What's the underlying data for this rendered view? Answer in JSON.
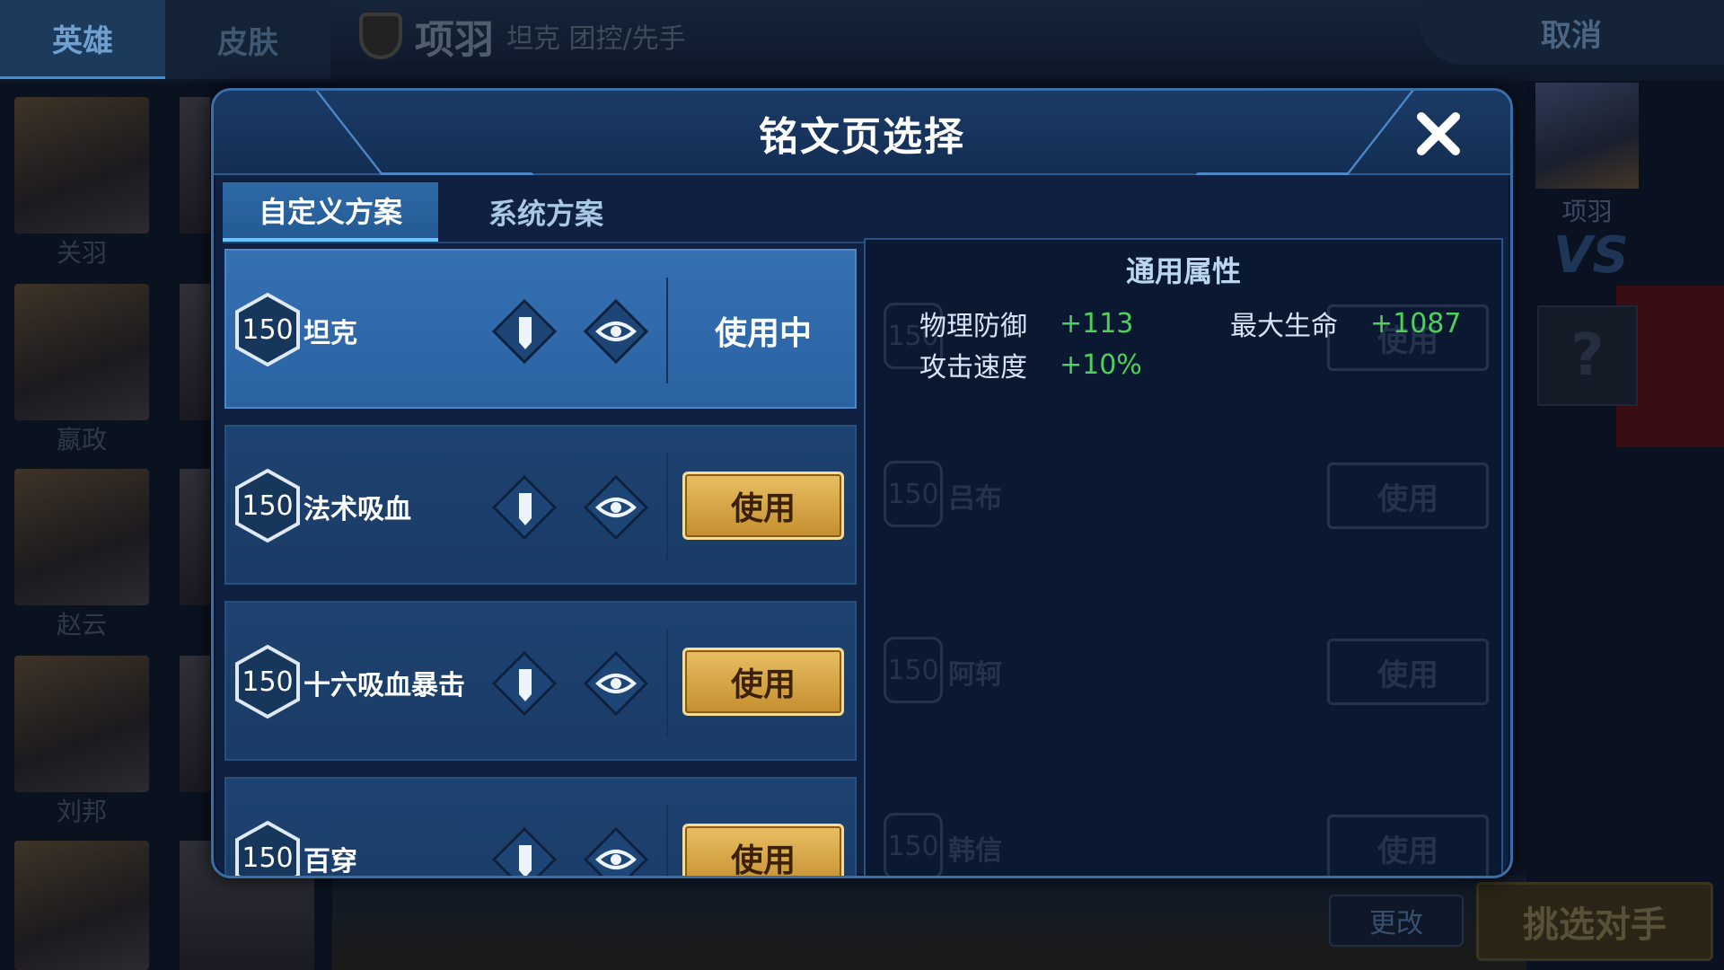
{
  "background": {
    "tabs": [
      "英雄",
      "皮肤"
    ],
    "hero_name": "项羽",
    "hero_role": "坦克 团控/先手",
    "cancel_label": "取消",
    "hero_list": [
      "关羽",
      "嬴政",
      "赵云",
      "刘邦"
    ],
    "opponent_name": "项羽",
    "vs_label": "VS",
    "unknown_label": "?",
    "change_label": "更改",
    "pick_label": "挑选对手"
  },
  "modal": {
    "title": "铭文页选择",
    "close_icon": "close-icon",
    "tabs": [
      {
        "label": "自定义方案",
        "active": true
      },
      {
        "label": "系统方案",
        "active": false
      }
    ],
    "pages": [
      {
        "level": "150",
        "name": "坦克",
        "status": "使用中",
        "selected": true
      },
      {
        "level": "150",
        "name": "法术吸血",
        "button": "使用",
        "selected": false
      },
      {
        "level": "150",
        "name": "十六吸血暴击",
        "button": "使用",
        "selected": false
      },
      {
        "level": "150",
        "name": "百穿",
        "button": "使用",
        "selected": false
      }
    ],
    "ghost_pages": [
      {
        "level": "150",
        "name": "",
        "button": "使用"
      },
      {
        "level": "150",
        "name": "吕布",
        "button": "使用"
      },
      {
        "level": "150",
        "name": "阿轲",
        "button": "使用"
      },
      {
        "level": "150",
        "name": "韩信",
        "button": "使用"
      }
    ],
    "attributes": {
      "title": "通用属性",
      "items": [
        {
          "label": "物理防御",
          "value": "+113"
        },
        {
          "label": "最大生命",
          "value": "+1087"
        },
        {
          "label": "攻击速度",
          "value": "+10%"
        }
      ]
    }
  },
  "colors": {
    "accent_blue": "#3470b2",
    "gold_button": "#d9a847",
    "positive_green": "#4ed05a"
  }
}
